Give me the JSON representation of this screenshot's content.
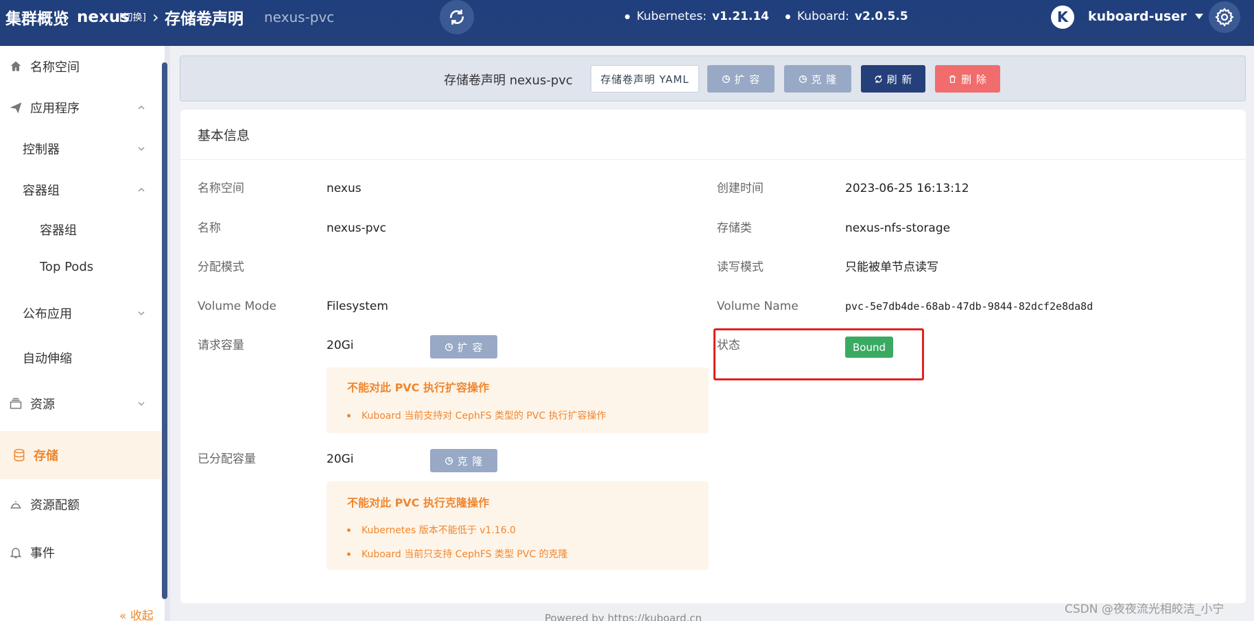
{
  "header": {
    "crumb1": "集群概览",
    "crumb2": "nexus",
    "switch_label": "[切换]",
    "crumb3": "存储卷声明",
    "crumb4": "nexus-pvc",
    "k8s_label": "Kubernetes:",
    "k8s_version": "v1.21.14",
    "kuboard_label": "Kuboard:",
    "kuboard_version": "v2.0.5.5",
    "avatar_letter": "K",
    "username": "kuboard-user"
  },
  "sidebar": {
    "items": [
      {
        "label": "名称空间",
        "icon": "home-icon"
      },
      {
        "label": "应用程序",
        "icon": "send-icon"
      },
      {
        "label": "控制器"
      },
      {
        "label": "容器组"
      },
      {
        "label": "容器组"
      },
      {
        "label": "Top Pods"
      },
      {
        "label": "公布应用"
      },
      {
        "label": "自动伸缩"
      },
      {
        "label": "资源",
        "icon": "layers-icon"
      },
      {
        "label": "存储",
        "icon": "database-icon"
      },
      {
        "label": "资源配额",
        "icon": "bell-service-icon"
      },
      {
        "label": "事件",
        "icon": "bell-icon"
      }
    ],
    "collapse_label": "收起"
  },
  "toolbar": {
    "title": "存储卷声明 nexus-pvc",
    "yaml_btn": "存储卷声明 YAML",
    "expand_btn": "扩 容",
    "clone_btn": "克 隆",
    "refresh_btn": "刷 新",
    "delete_btn": "删 除"
  },
  "card": {
    "title": "基本信息",
    "fields": {
      "namespace_label": "名称空间",
      "namespace_value": "nexus",
      "created_label": "创建时间",
      "created_value": "2023-06-25 16:13:12",
      "name_label": "名称",
      "name_value": "nexus-pvc",
      "storage_class_label": "存储类",
      "storage_class_value": "nexus-nfs-storage",
      "alloc_mode_label": "分配模式",
      "alloc_mode_value": "",
      "access_mode_label": "读写模式",
      "access_mode_value": "只能被单节点读写",
      "volume_mode_label": "Volume Mode",
      "volume_mode_value": "Filesystem",
      "volume_name_label": "Volume Name",
      "volume_name_value": "pvc-5e7db4de-68ab-47db-9844-82dcf2e8da8d",
      "request_label": "请求容量",
      "request_value": "20Gi",
      "status_label": "状态",
      "status_value": "Bound",
      "allocated_label": "已分配容量",
      "allocated_value": "20Gi"
    },
    "expand_inline_btn": "扩 容",
    "clone_inline_btn": "克 隆",
    "expand_warning": {
      "title": "不能对此 PVC 执行扩容操作",
      "items": [
        "Kuboard 当前支持对 CephFS 类型的 PVC 执行扩容操作"
      ]
    },
    "clone_warning": {
      "title": "不能对此 PVC 执行克隆操作",
      "items": [
        "Kubernetes 版本不能低于 v1.16.0",
        "Kuboard 当前只支持 CephFS 类型 PVC 的克隆"
      ]
    }
  },
  "footer": "Powered by https://kuboard.cn",
  "watermark": "CSDN @夜夜流光相皎洁_小宁",
  "colors": {
    "header_bg": "#23407a",
    "accent_orange": "#f0862e",
    "status_green": "#3aaa62",
    "delete_red": "#f16c6c",
    "highlight_red": "#e02020"
  }
}
